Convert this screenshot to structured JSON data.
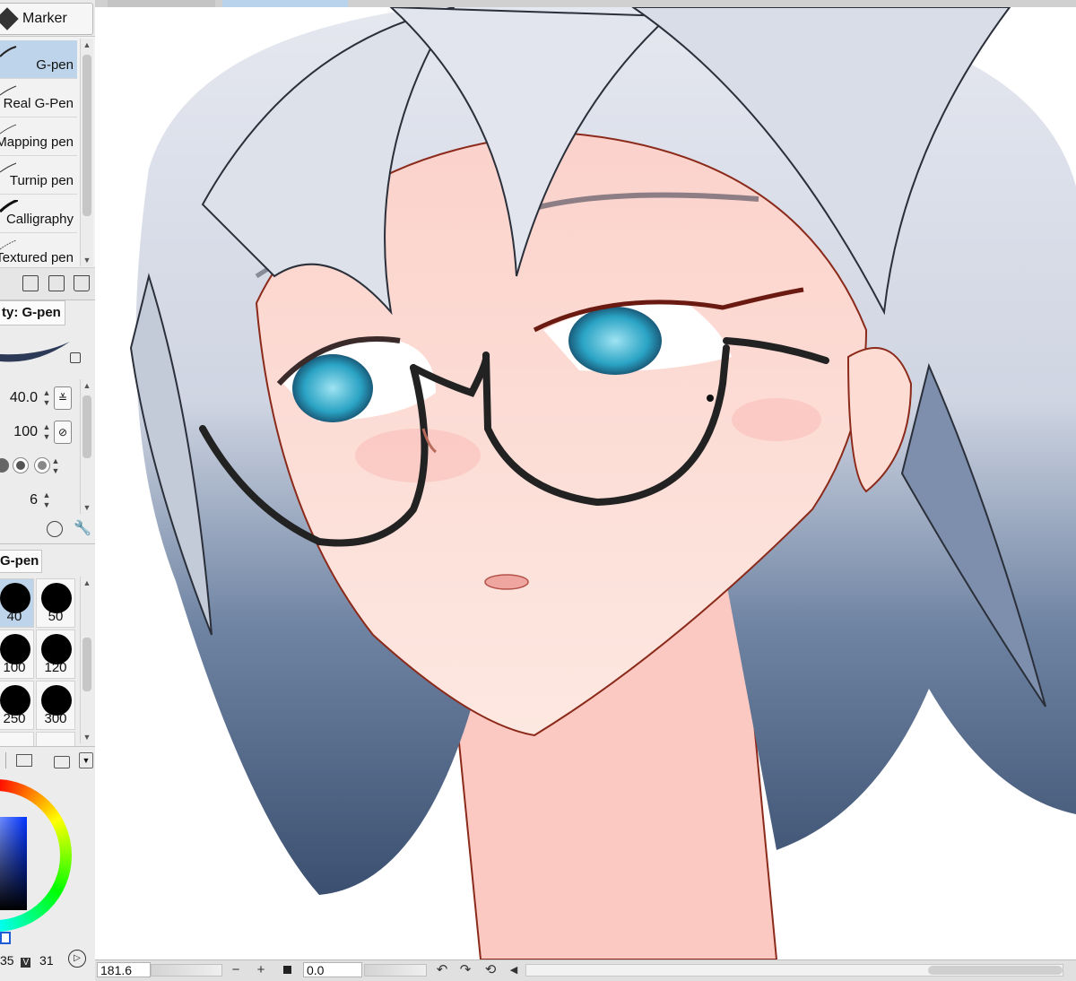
{
  "sub_tool": {
    "group_label": "Marker",
    "items": [
      {
        "label": "G-pen",
        "selected": true
      },
      {
        "label": "Real G-Pen",
        "selected": false
      },
      {
        "label": "Mapping pen",
        "selected": false
      },
      {
        "label": "Turnip pen",
        "selected": false
      },
      {
        "label": "Calligraphy",
        "selected": false
      },
      {
        "label": "Textured pen",
        "selected": false
      }
    ],
    "actions": [
      "import-icon",
      "duplicate-icon",
      "trash-icon"
    ]
  },
  "tool_property": {
    "title": "ty: G-pen",
    "brush_size": "40.0",
    "opacity": "100",
    "anti_aliasing_steps": 4,
    "stabilization": "6"
  },
  "brush_size_panel": {
    "title": "G-pen",
    "sizes": [
      "40",
      "50",
      "100",
      "120",
      "250",
      "300"
    ],
    "selected": "40"
  },
  "color": {
    "main_color": "#0033ff",
    "hue_value": "35",
    "v_label": "V",
    "v_value": "31"
  },
  "status_bar": {
    "zoom": "181.6",
    "zoom_out": "−",
    "zoom_in": "+",
    "rotation": "0.0"
  },
  "colors": {
    "selected_bg": "#bed4ea",
    "hair_light": "#dfe3ee",
    "hair_dark": "#3f5677",
    "skin": "#fde8e1",
    "eye": "#2aa3c4"
  }
}
